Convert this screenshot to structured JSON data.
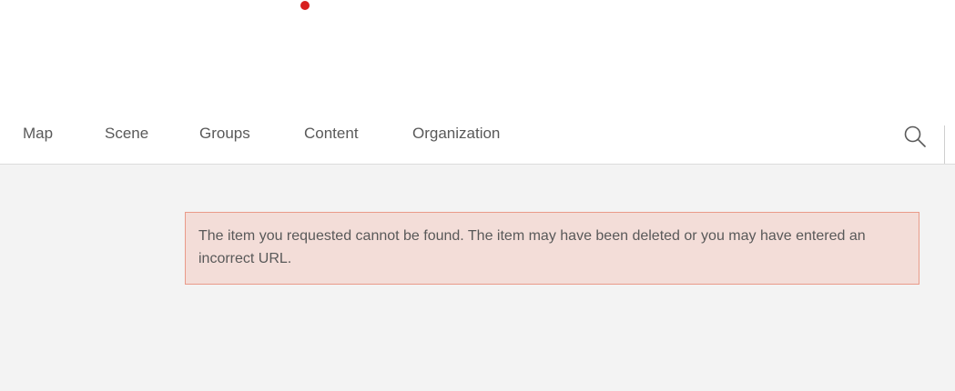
{
  "nav": {
    "items": [
      {
        "label": "Map"
      },
      {
        "label": "Scene"
      },
      {
        "label": "Groups"
      },
      {
        "label": "Content"
      },
      {
        "label": "Organization"
      }
    ]
  },
  "search": {
    "icon": "search-icon"
  },
  "alert": {
    "message": "The item you requested cannot be found. The item may have been deleted or you may have entered an incorrect URL."
  },
  "colors": {
    "brand_dot": "#d7201f",
    "alert_background": "#f3ddd8",
    "alert_border": "#e99a89",
    "page_background": "#f3f3f3"
  }
}
